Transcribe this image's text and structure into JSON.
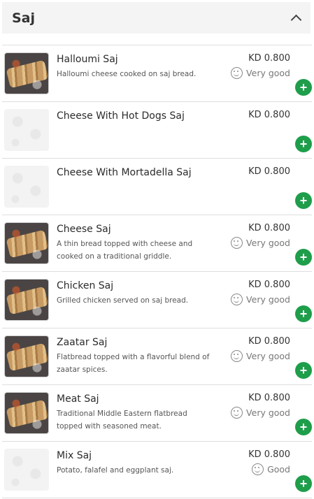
{
  "section": {
    "title": "Saj",
    "collapse_icon": "chevron-up-icon"
  },
  "items": [
    {
      "name": "Halloumi Saj",
      "description": "Halloumi cheese cooked on saj bread.",
      "price": "KD 0.800",
      "rating": "Very good",
      "image": "photo"
    },
    {
      "name": "Cheese With Hot Dogs Saj",
      "description": "",
      "price": "KD 0.800",
      "rating": "",
      "image": "placeholder"
    },
    {
      "name": "Cheese With Mortadella Saj",
      "description": "",
      "price": "KD 0.800",
      "rating": "",
      "image": "placeholder"
    },
    {
      "name": "Cheese Saj",
      "description": "A thin bread topped with cheese and cooked on a traditional griddle.",
      "price": "KD 0.800",
      "rating": "Very good",
      "image": "photo"
    },
    {
      "name": "Chicken Saj",
      "description": "Grilled chicken served on saj bread.",
      "price": "KD 0.800",
      "rating": "Very good",
      "image": "photo"
    },
    {
      "name": "Zaatar Saj",
      "description": "Flatbread topped with a flavorful blend of zaatar spices.",
      "price": "KD 0.800",
      "rating": "Very good",
      "image": "photo"
    },
    {
      "name": "Meat Saj",
      "description": "Traditional Middle Eastern flatbread topped with seasoned meat.",
      "price": "KD 0.800",
      "rating": "Very good",
      "image": "photo"
    },
    {
      "name": "Mix Saj",
      "description": "Potato, falafel and eggplant saj.",
      "price": "KD 0.800",
      "rating": "Good",
      "image": "placeholder"
    }
  ],
  "add_label": "+",
  "colors": {
    "accent": "#1e9e4a",
    "header_bg": "#f4f4f4"
  }
}
